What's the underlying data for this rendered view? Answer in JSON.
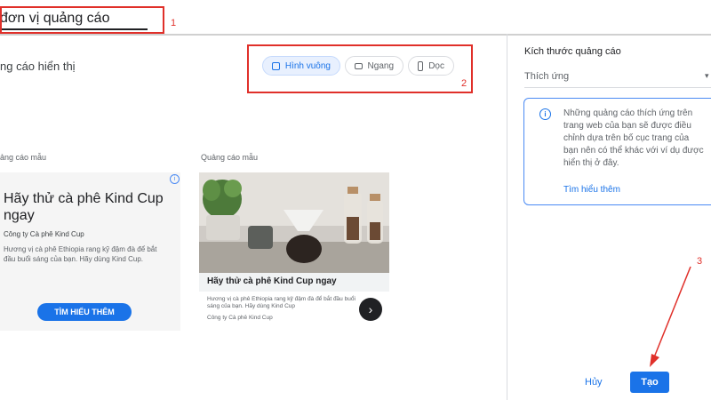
{
  "header": {
    "title_value": "đơn vị quảng cáo"
  },
  "annotations": {
    "num1": "1",
    "num2": "2",
    "num3": "3"
  },
  "left_panel": {
    "section_title": "ng cáo hiển thị",
    "format_buttons": [
      {
        "label": "Hình vuông",
        "icon": "square-icon",
        "selected": true
      },
      {
        "label": "Ngang",
        "icon": "landscape-icon",
        "selected": false
      },
      {
        "label": "Dọc",
        "icon": "portrait-icon",
        "selected": false
      }
    ],
    "sample1_label": "ảng cáo mẫu",
    "sample2_label": "Quảng cáo mẫu",
    "ad1": {
      "headline": "Hãy thử cà phê Kind Cup ngay",
      "company": "Công ty Cà phê Kind Cup",
      "description": "Hương vị cà phê Ethiopia rang kỹ đậm đà để bắt đầu buổi sáng của bạn. Hãy dùng Kind Cup.",
      "cta": "TÌM HIỂU THÊM",
      "info_icon": "info-icon"
    },
    "ad2": {
      "headline": "Hãy thử cà phê Kind Cup ngay",
      "description": "Hương vị cà phê Ethiopia rang kỹ đậm đà để bắt đầu buổi sáng của bạn. Hãy dùng Kind Cup",
      "company": "Công ty Cà phê Kind Cup",
      "next_icon": "chevron-right-icon"
    }
  },
  "right_panel": {
    "size_title": "Kích thước quảng cáo",
    "size_select_value": "Thích ứng",
    "info_text": "Những quảng cáo thích ứng trên trang web của bạn sẽ được điều chỉnh dựa trên bố cục trang của bạn nên có thể khác với ví dụ được hiển thị ở đây.",
    "info_link": "Tìm hiểu thêm",
    "cancel_label": "Hủy",
    "create_label": "Tạo"
  },
  "colors": {
    "accent": "#1a73e8",
    "annotation_red": "#e0302a"
  }
}
